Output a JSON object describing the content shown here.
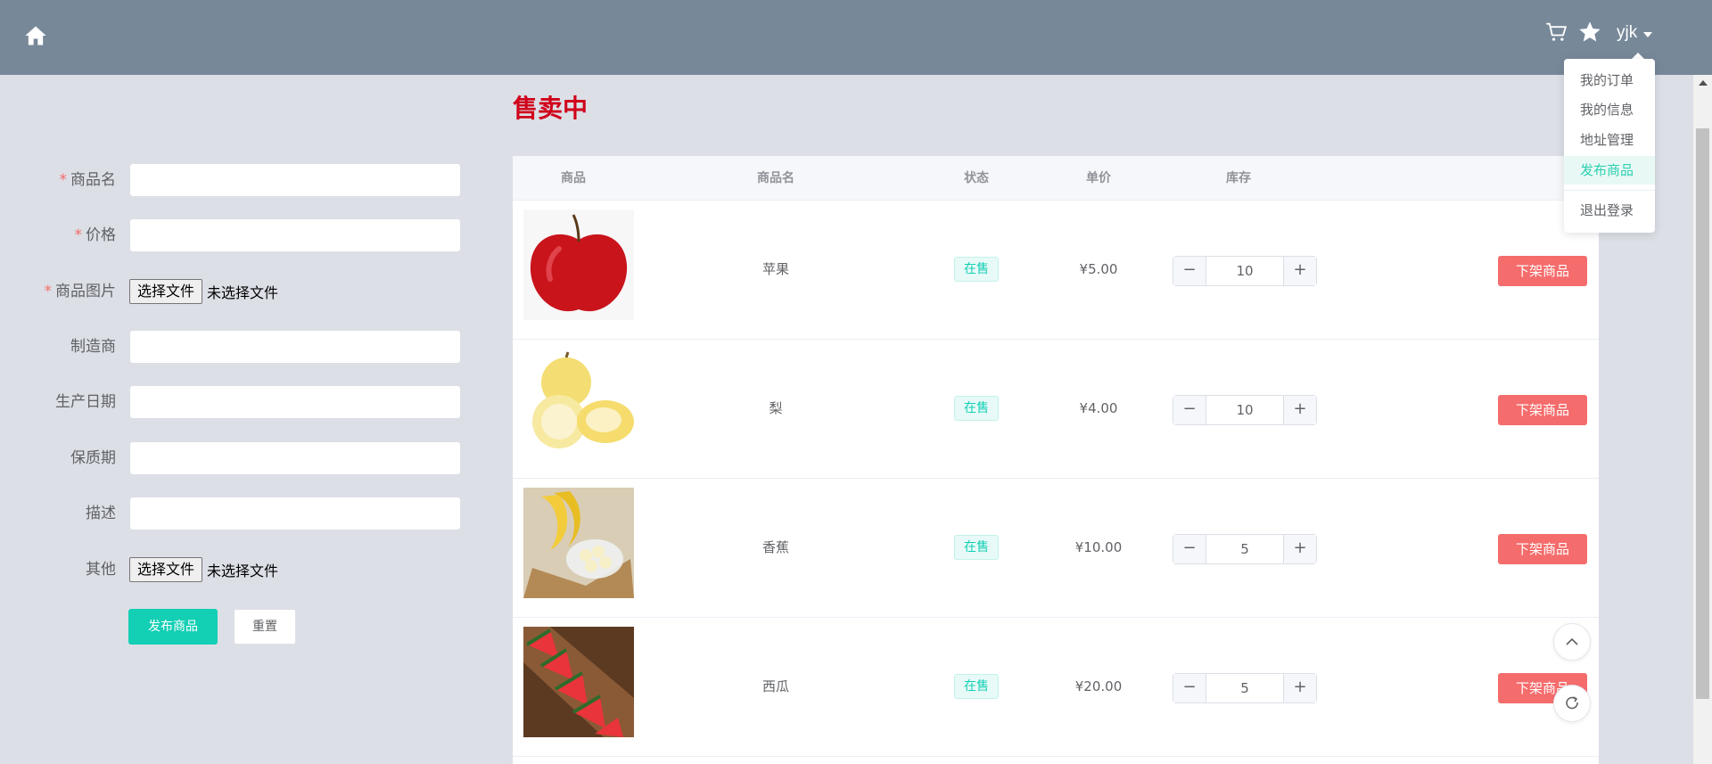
{
  "header": {
    "user_name": "yjk",
    "icons": [
      "home-icon",
      "cart-icon",
      "star-icon",
      "caret-down-icon"
    ]
  },
  "user_menu": {
    "items": [
      {
        "label": "我的订单",
        "active": false
      },
      {
        "label": "我的信息",
        "active": false
      },
      {
        "label": "地址管理",
        "active": false
      },
      {
        "label": "发布商品",
        "active": true
      },
      {
        "label": "退出登录",
        "active": false
      }
    ]
  },
  "form": {
    "fields": [
      {
        "label": "商品名",
        "required": true,
        "type": "text"
      },
      {
        "label": "价格",
        "required": true,
        "type": "text"
      },
      {
        "label": "商品图片",
        "required": true,
        "type": "file",
        "button": "选择文件",
        "status": "未选择文件"
      },
      {
        "label": "制造商",
        "required": false,
        "type": "text"
      },
      {
        "label": "生产日期",
        "required": false,
        "type": "text"
      },
      {
        "label": "保质期",
        "required": false,
        "type": "text"
      },
      {
        "label": "描述",
        "required": false,
        "type": "text"
      },
      {
        "label": "其他",
        "required": false,
        "type": "file",
        "button": "选择文件",
        "status": "未选择文件"
      }
    ],
    "submit_label": "发布商品",
    "reset_label": "重置"
  },
  "products": {
    "title": "售卖中",
    "columns": [
      "商品",
      "商品名",
      "状态",
      "单价",
      "库存"
    ],
    "rows": [
      {
        "name": "苹果",
        "status": "在售",
        "price": "¥5.00",
        "stock": "10",
        "action": "下架商品",
        "image": "apple"
      },
      {
        "name": "梨",
        "status": "在售",
        "price": "¥4.00",
        "stock": "10",
        "action": "下架商品",
        "image": "pear"
      },
      {
        "name": "香蕉",
        "status": "在售",
        "price": "¥10.00",
        "stock": "5",
        "action": "下架商品",
        "image": "banana"
      },
      {
        "name": "西瓜",
        "status": "在售",
        "price": "¥20.00",
        "stock": "5",
        "action": "下架商品",
        "image": "watermelon"
      }
    ],
    "stepper_minus": "−",
    "stepper_plus": "+"
  },
  "floating": {
    "icons": [
      "chevron-up-icon",
      "refresh-icon"
    ]
  },
  "colors": {
    "header_bg": "#778899",
    "accent": "#13cfb4",
    "danger": "#f56c6c",
    "title_red": "#d0021b",
    "page_bg": "#dcdfe6"
  }
}
